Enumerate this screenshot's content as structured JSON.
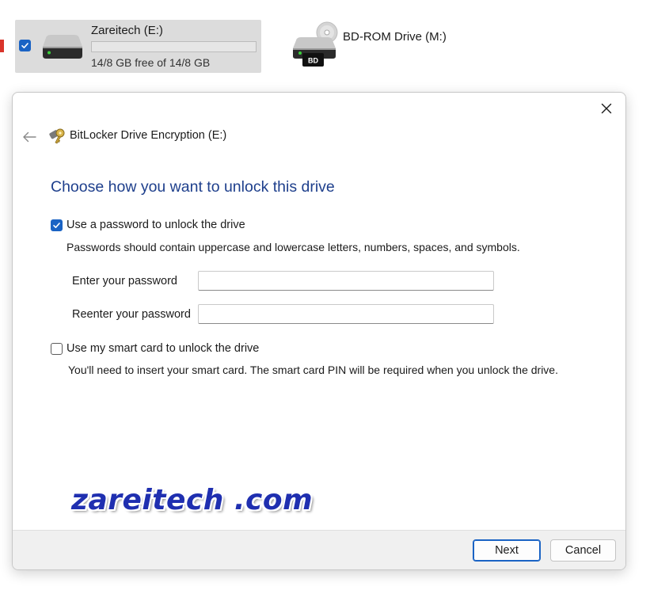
{
  "explorer": {
    "drive": {
      "name": "Zareitech (E:)",
      "free_text": "14/8 GB free of 14/8 GB",
      "used_fraction": 0.0,
      "selected": true
    },
    "bd_drive": {
      "name": "BD-ROM Drive (M:)",
      "badge": "BD"
    }
  },
  "dialog": {
    "title": "BitLocker Drive Encryption (E:)",
    "heading": "Choose how you want to unlock this drive",
    "password_option": {
      "label": "Use a password to unlock the drive",
      "checked": true,
      "hint": "Passwords should contain uppercase and lowercase letters, numbers, spaces, and symbols.",
      "enter_label": "Enter your password",
      "enter_value": "",
      "reenter_label": "Reenter your password",
      "reenter_value": ""
    },
    "smartcard_option": {
      "label": "Use my smart card to unlock the drive",
      "checked": false,
      "hint": "You'll need to insert your smart card. The smart card PIN will be required when you unlock the drive."
    },
    "watermark": "zareitech .com",
    "buttons": {
      "next": "Next",
      "cancel": "Cancel"
    }
  },
  "colors": {
    "accent": "#1a63c4",
    "heading": "#1e3f8c",
    "tile_selected": "#dcdcdc",
    "footer": "#f0f0f0"
  },
  "icons": {
    "back": "arrow-left-icon",
    "close": "close-icon",
    "bitlocker": "bitlocker-key-icon",
    "drive": "hard-drive-icon",
    "disc": "bd-rom-drive-icon"
  }
}
